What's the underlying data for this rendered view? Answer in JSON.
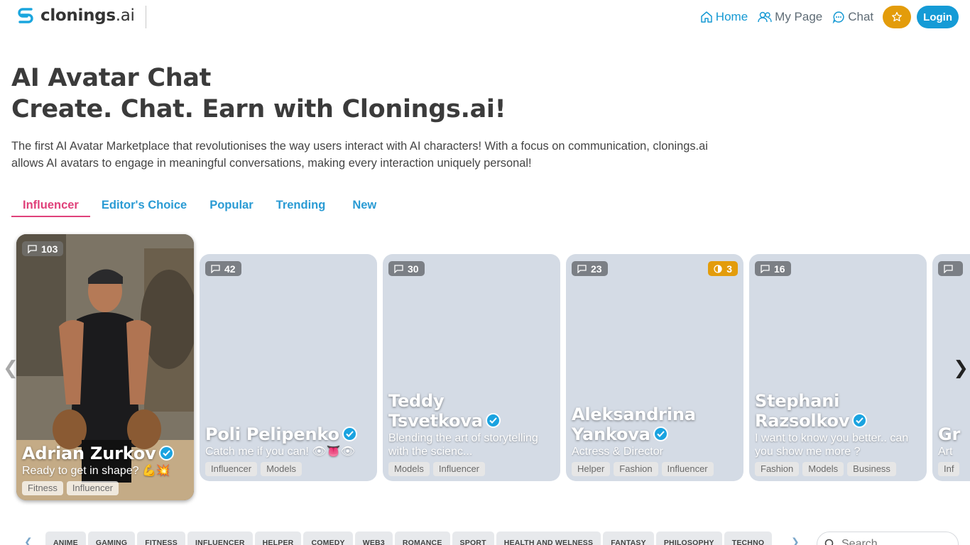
{
  "header": {
    "logo_text": "clonings",
    "logo_suffix": ".ai",
    "nav": [
      {
        "label": "Home",
        "icon": "home-icon",
        "active": true
      },
      {
        "label": "My Page",
        "icon": "users-icon",
        "active": false
      },
      {
        "label": "Chat",
        "icon": "chat-icon",
        "active": false
      }
    ],
    "login_label": "Login"
  },
  "hero": {
    "title_line1": "AI Avatar Chat",
    "title_line2": "Create. Chat. Earn with Clonings.ai!",
    "description": "The first AI Avatar Marketplace that revolutionises the way users interact with AI characters! With a focus on communication, clonings.ai allows AI avatars to engage in meaningful conversations, making every interaction uniquely personal!"
  },
  "tabs": [
    "Influencer",
    "Editor's Choice",
    "Popular",
    "Trending",
    "New"
  ],
  "cards": [
    {
      "chats": "103",
      "name": "Adrian  Zurkov",
      "desc": "Ready to get in shape? 💪💥",
      "tags": [
        "Fitness",
        "Influencer"
      ]
    },
    {
      "chats": "42",
      "name": "Poli  Pelipenko",
      "desc": "Catch me if you can! 👁👅👁",
      "tags": [
        "Influencer",
        "Models"
      ]
    },
    {
      "chats": "30",
      "name": "Teddy Tsvetkova",
      "desc": "Blending the art of storytelling with the scienc...",
      "tags": [
        "Models",
        "Influencer"
      ]
    },
    {
      "chats": "23",
      "coins": "3",
      "name": "Aleksandrina Yankova",
      "desc": "Actress & Director",
      "tags": [
        "Helper",
        "Fashion",
        "Influencer"
      ]
    },
    {
      "chats": "16",
      "name": "Stephani Razsolkov",
      "desc": "I want to know you better.. can you show me more ?",
      "tags": [
        "Fashion",
        "Models",
        "Business"
      ]
    },
    {
      "chats": "",
      "name": "Gr",
      "desc": "Art",
      "tags": [
        "Inf"
      ]
    }
  ],
  "categories": [
    "ANIME",
    "GAMING",
    "FITNESS",
    "INFLUENCER",
    "HELPER",
    "COMEDY",
    "WEB3",
    "ROMANCE",
    "SPORT",
    "HEALTH AND WELNESS",
    "FANTASY",
    "PHILOSOPHY",
    "TECHNO"
  ],
  "search": {
    "placeholder": "Search"
  },
  "colors": {
    "accent": "#159bd6",
    "active_tab": "#e0417a",
    "coin": "#e39c0b"
  }
}
